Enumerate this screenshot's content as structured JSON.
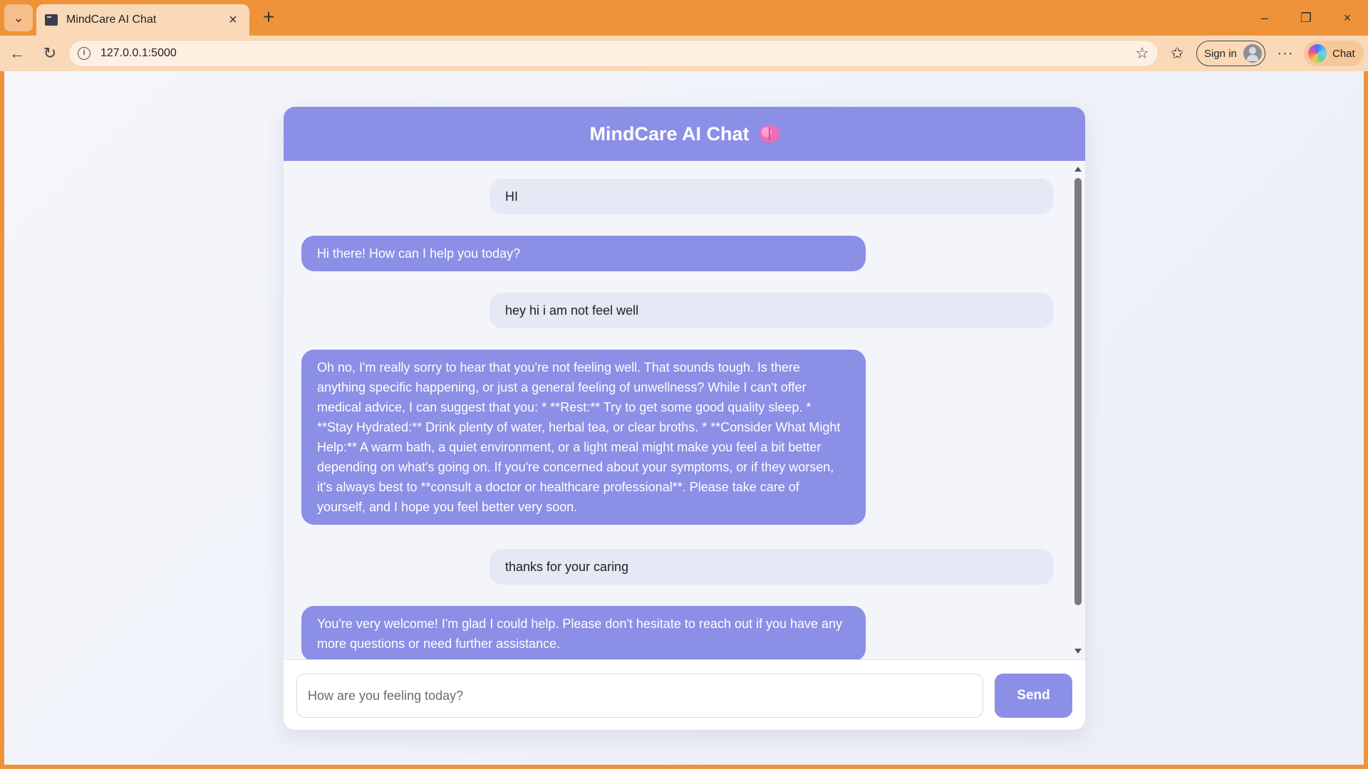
{
  "browser": {
    "tab_title": "MindCare AI Chat",
    "url": "127.0.0.1:5000",
    "sign_in_label": "Sign in",
    "copilot_label": "Chat",
    "icons": {
      "tab_menu": "chevron-down-icon",
      "tab_close": "close-icon",
      "new_tab": "plus-icon",
      "minimize": "minimize-icon",
      "restore": "restore-icon",
      "close_window": "close-icon",
      "back": "arrow-left-icon",
      "reload": "reload-icon",
      "site_info": "info-icon",
      "favorite": "star-icon",
      "favorites": "favorites-icon",
      "more": "more-icon"
    }
  },
  "chat": {
    "title": "MindCare AI Chat",
    "title_icon": "brain-icon",
    "messages": [
      {
        "role": "user",
        "text": "HI"
      },
      {
        "role": "bot",
        "text": "Hi there! How can I help you today?"
      },
      {
        "role": "user",
        "text": "hey hi i am not feel well"
      },
      {
        "role": "bot",
        "text": "Oh no, I'm really sorry to hear that you're not feeling well. That sounds tough. Is there anything specific happening, or just a general feeling of unwellness? While I can't offer medical advice, I can suggest that you: * **Rest:** Try to get some good quality sleep. * **Stay Hydrated:** Drink plenty of water, herbal tea, or clear broths. * **Consider What Might Help:** A warm bath, a quiet environment, or a light meal might make you feel a bit better depending on what's going on. If you're concerned about your symptoms, or if they worsen, it's always best to **consult a doctor or healthcare professional**. Please take care of yourself, and I hope you feel better very soon."
      },
      {
        "role": "user",
        "text": "thanks for your caring"
      },
      {
        "role": "bot",
        "text": "You're very welcome! I'm glad I could help. Please don't hesitate to reach out if you have any more questions or need further assistance."
      }
    ],
    "input_placeholder": "How are you feeling today?",
    "input_value": "",
    "send_label": "Send"
  },
  "colors": {
    "accent": "#8b8fe6",
    "user_bubble": "#e6e8f5",
    "browser_frame": "#ef933a"
  }
}
